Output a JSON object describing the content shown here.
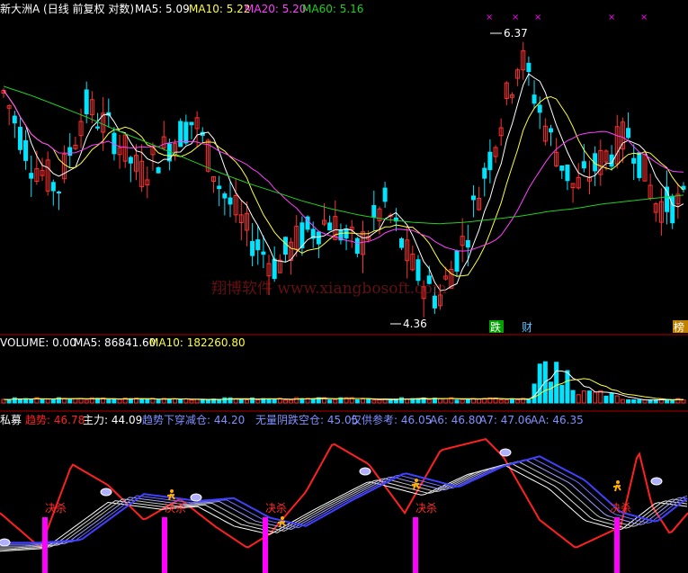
{
  "header": {
    "main_title": "新大洲A (日线 前复权 对数)",
    "ma5": "MA5: 5.09",
    "ma10": "MA10: 5.22",
    "ma20": "MA20: 5.20",
    "ma60": "MA60: 5.16"
  },
  "volume_header": {
    "label": "VOLUME: 0.00",
    "ma5": "MA5: 86841.60",
    "ma10": "MA10: 182260.80"
  },
  "indicator_header": {
    "name": "私募",
    "trend": "趋势: 46.78",
    "main_force": "主力: 44.09",
    "cross_down": "趋势下穿减仓: 44.20",
    "no_shadow": "无量阴跌空仓: 45.05",
    "reference": "仅供参考: 46.05",
    "a6": "A6: 46.80",
    "a7": "A7: 47.06",
    "aa": "AA: 46.35"
  },
  "annotations": {
    "high_price": "6.37",
    "low_price": "4.36",
    "kill_label": "决杀",
    "tag_die": "跌",
    "tag_cai": "财",
    "tag_bang": "榜"
  },
  "watermark": "翔博软件 www.xiangbosoft.com",
  "colors": {
    "up": "#ff3030",
    "down": "#00e5ff",
    "ma5": "#ffffff",
    "ma10": "#ffff40",
    "ma20": "#ff40ff",
    "ma60": "#20d020",
    "trend": "#ff2020",
    "blue": "#4040ff",
    "magenta": "#ff00ff"
  },
  "chart_data": {
    "type": "candlestick",
    "price_high": 6.37,
    "price_low": 4.36,
    "ma60": [
      5.95,
      5.88,
      5.8,
      5.72,
      5.63,
      5.55,
      5.47,
      5.39,
      5.31,
      5.24,
      5.18,
      5.12,
      5.07,
      5.03,
      5.0,
      4.98,
      4.97,
      4.98,
      5.0,
      5.02,
      5.05,
      5.07,
      5.1,
      5.12,
      5.14,
      5.16
    ],
    "candles": [
      [
        5.6,
        5.9,
        6.1,
        5.5
      ],
      [
        5.9,
        5.4,
        6.0,
        5.3
      ],
      [
        5.4,
        5.2,
        5.5,
        5.1
      ],
      [
        5.2,
        5.8,
        5.9,
        5.1
      ],
      [
        5.8,
        5.6,
        6.0,
        5.5
      ],
      [
        5.6,
        5.3,
        5.7,
        5.2
      ],
      [
        5.3,
        5.5,
        5.6,
        5.2
      ],
      [
        5.5,
        5.7,
        5.9,
        5.4
      ],
      [
        5.7,
        5.2,
        5.8,
        5.1
      ],
      [
        5.2,
        4.9,
        5.3,
        4.8
      ],
      [
        4.9,
        4.7,
        5.0,
        4.6
      ],
      [
        4.7,
        4.9,
        5.0,
        4.6
      ],
      [
        4.9,
        5.0,
        5.1,
        4.8
      ],
      [
        5.0,
        4.8,
        5.1,
        4.7
      ],
      [
        4.8,
        5.1,
        5.2,
        4.7
      ],
      [
        5.1,
        4.7,
        5.2,
        4.5
      ],
      [
        4.7,
        4.5,
        4.8,
        4.36
      ],
      [
        4.5,
        4.9,
        5.0,
        4.4
      ],
      [
        4.9,
        5.5,
        5.7,
        4.8
      ],
      [
        5.5,
        6.2,
        6.37,
        5.4
      ],
      [
        6.2,
        5.6,
        6.3,
        5.4
      ],
      [
        5.6,
        5.2,
        5.7,
        5.1
      ],
      [
        5.2,
        5.4,
        5.5,
        5.1
      ],
      [
        5.4,
        5.6,
        5.7,
        5.3
      ],
      [
        5.6,
        5.1,
        5.7,
        5.0
      ],
      [
        5.1,
        5.1,
        5.3,
        4.9
      ]
    ]
  }
}
